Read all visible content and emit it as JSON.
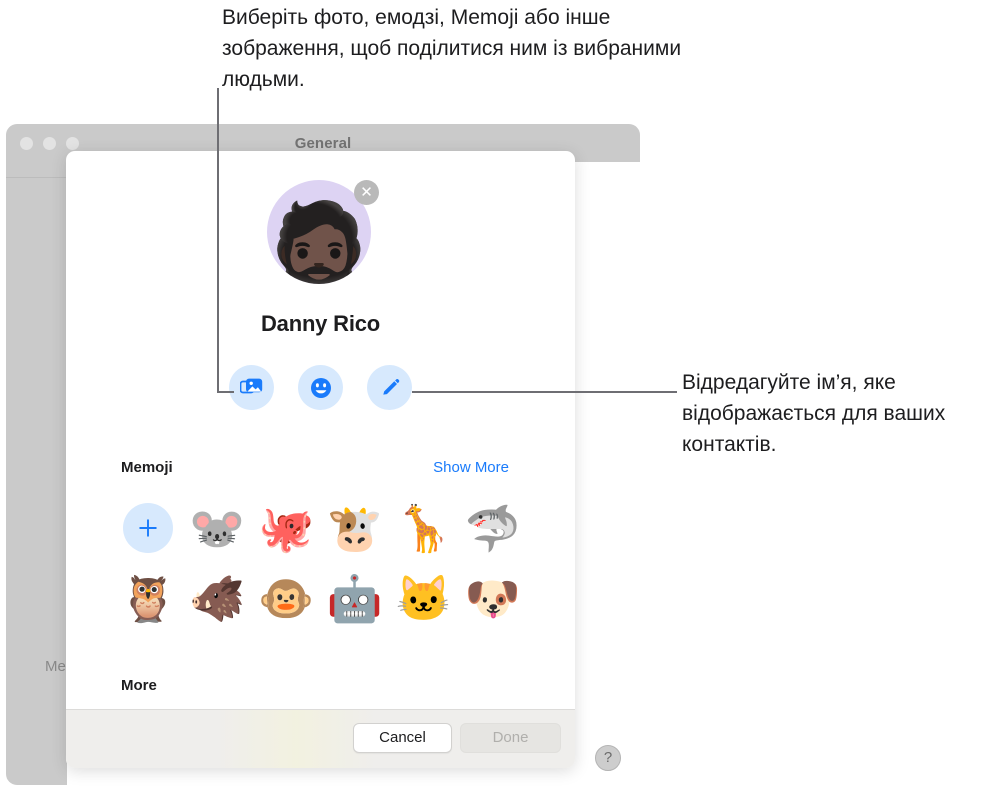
{
  "annotations": {
    "top": "Виберіть фото, емодзі, Memoji або інше зображення, щоб поділитися ним із вибраними людьми.",
    "right": "Відредагуйте ім’я, яке відображається для ваших контактів."
  },
  "background_window": {
    "title": "General",
    "sidebar_partial_label": "Me",
    "help_label": "?"
  },
  "dialog": {
    "avatar": {
      "glyph": "🧔🏿",
      "remove_label": "✕"
    },
    "display_name": "Danny Rico",
    "actions": [
      {
        "name": "photos",
        "icon": "photo-stack-icon"
      },
      {
        "name": "emoji",
        "icon": "smiley-face-icon"
      },
      {
        "name": "edit-name",
        "icon": "pencil-icon"
      }
    ],
    "memoji_section": {
      "title": "Memoji",
      "show_more_label": "Show More",
      "items": [
        {
          "type": "add",
          "label": "+"
        },
        {
          "type": "memoji",
          "glyph": "🐭",
          "label": "mouse"
        },
        {
          "type": "memoji",
          "glyph": "🐙",
          "label": "octopus"
        },
        {
          "type": "memoji",
          "glyph": "🐮",
          "label": "cow"
        },
        {
          "type": "memoji",
          "glyph": "🦒",
          "label": "giraffe"
        },
        {
          "type": "memoji",
          "glyph": "🦈",
          "label": "shark"
        },
        {
          "type": "memoji",
          "glyph": "🦉",
          "label": "owl"
        },
        {
          "type": "memoji",
          "glyph": "🐗",
          "label": "boar"
        },
        {
          "type": "memoji",
          "glyph": "🐵",
          "label": "monkey"
        },
        {
          "type": "memoji",
          "glyph": "🤖",
          "label": "robot"
        },
        {
          "type": "memoji",
          "glyph": "🐱",
          "label": "cat"
        },
        {
          "type": "memoji",
          "glyph": "🐶",
          "label": "dog"
        }
      ]
    },
    "more_section": {
      "title": "More"
    },
    "footer": {
      "cancel_label": "Cancel",
      "done_label": "Done"
    }
  },
  "colors": {
    "accent_blue": "#1a7bfb",
    "action_button_bg": "#d7e9fd",
    "avatar_bg": "#ddd3f3",
    "window_chrome": "#cacaca",
    "footer_bg": "#efeeec"
  }
}
